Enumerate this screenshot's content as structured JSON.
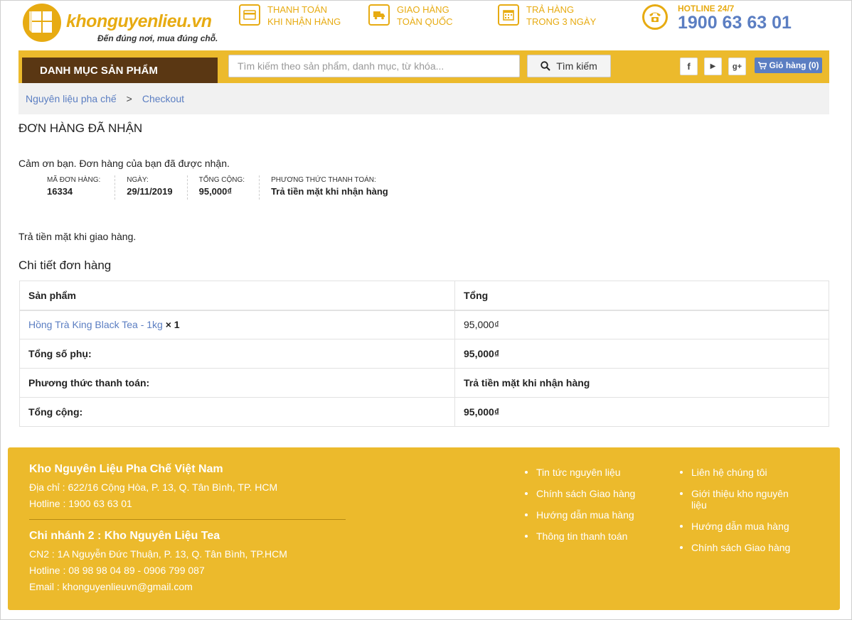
{
  "brand": {
    "name": "khonguyenlieu.vn",
    "slogan": "Đến đúng nơi, mua đúng chỗ.",
    "color": "#e7ab12"
  },
  "features": [
    {
      "icon": "credit-card-icon",
      "line1": "THANH TOÁN",
      "line2": "KHI NHẬN HÀNG"
    },
    {
      "icon": "truck-icon",
      "line1": "GIAO HÀNG",
      "line2": "TOÀN QUỐC"
    },
    {
      "icon": "calendar-icon",
      "line1": "TRẢ HÀNG",
      "line2": "TRONG 3 NGÀY"
    }
  ],
  "hotline": {
    "label": "HOTLINE 24/7",
    "number": "1900 63 63 01",
    "icon": "phone-icon"
  },
  "nav": {
    "category_label": "DANH MỤC SẢN PHẨM",
    "search_placeholder": "Tìm kiếm theo sản phẩm, danh mục, từ khóa...",
    "search_value": "",
    "search_button": "Tìm kiếm",
    "social": [
      {
        "icon": "facebook-icon",
        "glyph": "f"
      },
      {
        "icon": "youtube-icon",
        "glyph": "▶"
      },
      {
        "icon": "google-plus-icon",
        "glyph": "g+"
      }
    ],
    "cart_label": "Giỏ hàng (0)",
    "bar_color": "#ecba2c",
    "category_color": "#5a3713"
  },
  "breadcrumb": {
    "item1": "Nguyên liệu pha chế",
    "separator": ">",
    "item2": "Checkout"
  },
  "order": {
    "title": "ĐƠN HÀNG ĐÃ NHẬN",
    "thanks": "Cảm ơn bạn. Đơn hàng của bạn đã được nhận.",
    "overview": [
      {
        "label": "MÃ ĐƠN HÀNG:",
        "value": "16334"
      },
      {
        "label": "NGÀY:",
        "value": "29/11/2019"
      },
      {
        "label": "TỔNG CỘNG:",
        "value": "95,000₫"
      },
      {
        "label": "PHƯƠNG THỨC THANH TOÁN:",
        "value": "Trả tiền mặt khi nhận hàng"
      }
    ],
    "payment_note": "Trả tiền mặt khi giao hàng.",
    "details_title": "Chi tiết đơn hàng",
    "table": {
      "header_product": "Sản phẩm",
      "header_total": "Tổng",
      "product_name": "Hồng Trà King Black Tea - 1kg",
      "product_qty": "× 1",
      "product_total": "95,000₫",
      "subtotal_label": "Tổng số phụ:",
      "subtotal_value": "95,000₫",
      "payment_label": "Phương thức thanh toán:",
      "payment_value": "Trả tiền mặt khi nhận hàng",
      "total_label": "Tổng cộng:",
      "total_value": "95,000₫"
    }
  },
  "footer": {
    "main_name": "Kho Nguyên Liệu Pha Chế Việt Nam",
    "main_address": "Địa chỉ : 622/16 Cộng Hòa, P. 13, Q. Tân Bình, TP. HCM",
    "main_hotline": "Hotline : 1900 63 63 01",
    "branch_name": "Chi nhánh 2 : Kho Nguyên Liệu Tea",
    "branch_address": "CN2 : 1A Nguyễn Đức Thuận, P. 13, Q. Tân Bình, TP.HCM",
    "branch_hotline": "Hotline : 08 98 98 04 89 - 0906 799 087",
    "email": "Email : khonguyenlieuvn@gmail.com",
    "links_col1": [
      "Tin tức nguyên liệu",
      "Chính sách Giao hàng",
      "Hướng dẫn mua hàng",
      "Thông tin thanh toán"
    ],
    "links_col2": [
      "Liên hệ chúng tôi",
      "Giới thiệu kho nguyên liệu",
      "Hướng dẫn mua hàng",
      "Chính sách Giao hàng"
    ]
  }
}
